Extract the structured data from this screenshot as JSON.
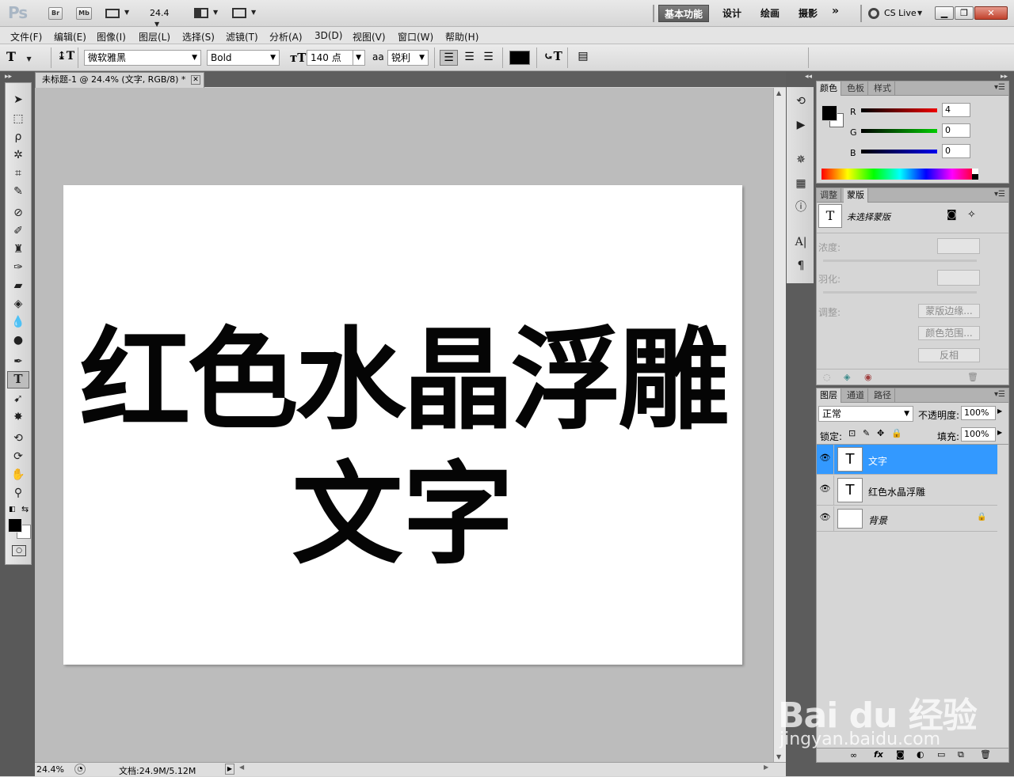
{
  "appbar": {
    "logo": "Ps",
    "bridge": "Br",
    "minibridge": "Mb",
    "zoom": "24.4",
    "workspaces": [
      "基本功能",
      "设计",
      "绘画",
      "摄影"
    ],
    "more": "»",
    "cs_live": "CS Live"
  },
  "menu": [
    "文件(F)",
    "编辑(E)",
    "图像(I)",
    "图层(L)",
    "选择(S)",
    "滤镜(T)",
    "分析(A)",
    "3D(D)",
    "视图(V)",
    "窗口(W)",
    "帮助(H)"
  ],
  "options": {
    "font_family": "微软雅黑",
    "font_style": "Bold",
    "font_size": "140 点",
    "aa_label": "aa",
    "antialias": "锐利",
    "text_color": "#000000"
  },
  "document": {
    "tab_title": "未标题-1 @ 24.4% (文字, RGB/8) *",
    "line1": "红色水晶浮雕",
    "line2": "文字",
    "zoom_status": "24.4%",
    "doc_info": "文档:24.9M/5.12M"
  },
  "color_panel": {
    "tabs": [
      "颜色",
      "色板",
      "样式"
    ],
    "r_label": "R",
    "g_label": "G",
    "b_label": "B",
    "r": "4",
    "g": "0",
    "b": "0"
  },
  "masks_panel": {
    "tabs": [
      "调整",
      "蒙版"
    ],
    "status": "未选择蒙版",
    "density_label": "浓度:",
    "feather_label": "羽化:",
    "refine_label": "调整:",
    "mask_edge_btn": "蒙版边缘...",
    "color_range_btn": "颜色范围...",
    "invert_btn": "反相"
  },
  "layers_panel": {
    "tabs": [
      "图层",
      "通道",
      "路径"
    ],
    "blend_mode": "正常",
    "opacity_label": "不透明度:",
    "opacity": "100%",
    "lock_label": "锁定:",
    "fill_label": "填充:",
    "fill": "100%",
    "layers": [
      {
        "name": "文字",
        "type_icon": "T",
        "selected": true
      },
      {
        "name": "红色水晶浮雕",
        "type_icon": "T",
        "selected": false
      },
      {
        "name": "背景",
        "type_icon": "",
        "selected": false
      }
    ]
  },
  "watermark": {
    "brand": "Bai du 经验",
    "url": "jingyan.baidu.com"
  },
  "colors": {
    "selection": "#3399ff",
    "active_ws": "#6b6b6b"
  }
}
